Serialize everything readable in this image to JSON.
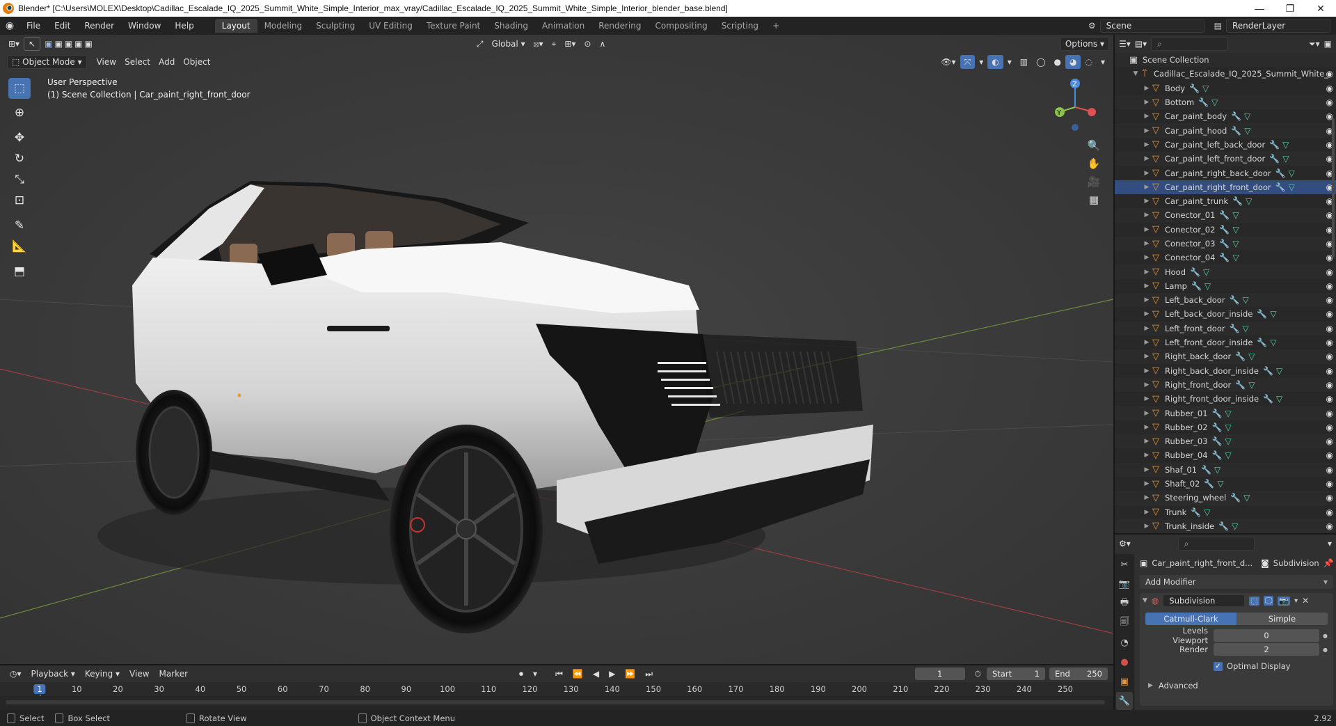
{
  "window": {
    "title": "Blender* [C:\\Users\\MOLEX\\Desktop\\Cadillac_Escalade_IQ_2025_Summit_White_Simple_Interior_max_vray/Cadillac_Escalade_IQ_2025_Summit_White_Simple_Interior_blender_base.blend]",
    "minimize": "—",
    "maximize": "❐",
    "close": "✕"
  },
  "menubar": {
    "menus": [
      "File",
      "Edit",
      "Render",
      "Window",
      "Help"
    ],
    "workspaces": [
      "Layout",
      "Modeling",
      "Sculpting",
      "UV Editing",
      "Texture Paint",
      "Shading",
      "Animation",
      "Rendering",
      "Compositing",
      "Scripting"
    ],
    "active_workspace": "Layout",
    "add_workspace": "+",
    "scene": "Scene",
    "view_layer": "RenderLayer"
  },
  "viewport": {
    "mode": "Object Mode",
    "menus": [
      "View",
      "Select",
      "Add",
      "Object"
    ],
    "orientation": "Global",
    "options": "Options",
    "overlay_line1": "User Perspective",
    "overlay_line2": "(1) Scene Collection | Car_paint_right_front_door",
    "gizmo": {
      "z": "Z",
      "y": "Y"
    },
    "tools": [
      "select-box",
      "cursor",
      "move",
      "rotate",
      "scale",
      "transform",
      "annotate",
      "measure",
      "add-cube"
    ]
  },
  "outliner": {
    "root": "Scene Collection",
    "collection": "Cadillac_Escalade_IQ_2025_Summit_White_",
    "items": [
      "Body",
      "Bottom",
      "Car_paint_body",
      "Car_paint_hood",
      "Car_paint_left_back_door",
      "Car_paint_left_front_door",
      "Car_paint_right_back_door",
      "Car_paint_right_front_door",
      "Car_paint_trunk",
      "Conector_01",
      "Conector_02",
      "Conector_03",
      "Conector_04",
      "Hood",
      "Lamp",
      "Left_back_door",
      "Left_back_door_inside",
      "Left_front_door",
      "Left_front_door_inside",
      "Right_back_door",
      "Right_back_door_inside",
      "Right_front_door",
      "Right_front_door_inside",
      "Rubber_01",
      "Rubber_02",
      "Rubber_03",
      "Rubber_04",
      "Shaf_01",
      "Shaft_02",
      "Steering_wheel",
      "Trunk",
      "Trunk_inside"
    ],
    "selected": "Car_paint_right_front_door"
  },
  "properties": {
    "object_name": "Car_paint_right_front_d...",
    "modifier_context": "Subdivision",
    "add_modifier": "Add Modifier",
    "modifier_name": "Subdivision",
    "tab_catmull": "Catmull-Clark",
    "tab_simple": "Simple",
    "levels_label": "Levels Viewport",
    "levels_value": "0",
    "render_label": "Render",
    "render_value": "2",
    "optimal_display": "Optimal Display",
    "advanced": "Advanced"
  },
  "timeline": {
    "menus": [
      "Playback",
      "Keying",
      "View",
      "Marker"
    ],
    "current_frame": "1",
    "start_label": "Start",
    "start_value": "1",
    "end_label": "End",
    "end_value": "250",
    "ticks": [
      "1",
      "10",
      "20",
      "30",
      "40",
      "50",
      "60",
      "70",
      "80",
      "90",
      "100",
      "110",
      "120",
      "130",
      "140",
      "150",
      "160",
      "170",
      "180",
      "190",
      "200",
      "210",
      "220",
      "230",
      "240",
      "250"
    ]
  },
  "status": {
    "select": "Select",
    "box_select": "Box Select",
    "rotate_view": "Rotate View",
    "context_menu": "Object Context Menu",
    "version": "2.92"
  }
}
